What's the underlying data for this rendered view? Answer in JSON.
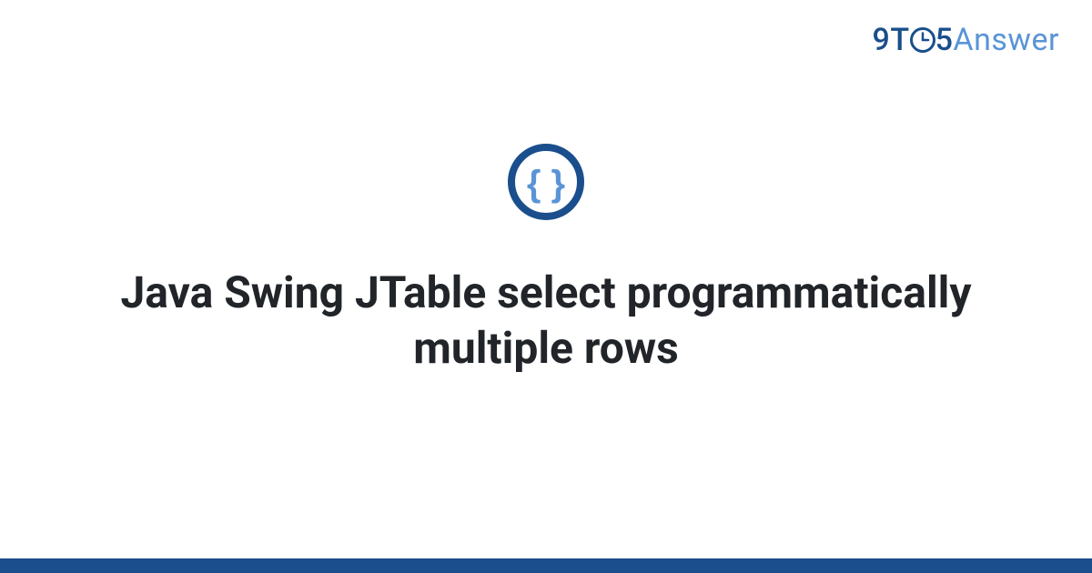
{
  "logo": {
    "part_9t": "9T",
    "part_5": "5",
    "part_answer": "Answer"
  },
  "category_icon": "code-braces-icon",
  "title": "Java Swing JTable select programmatically multiple rows",
  "colors": {
    "brand_dark": "#1a4e8c",
    "brand_light": "#5a94d6",
    "text": "#212529"
  }
}
